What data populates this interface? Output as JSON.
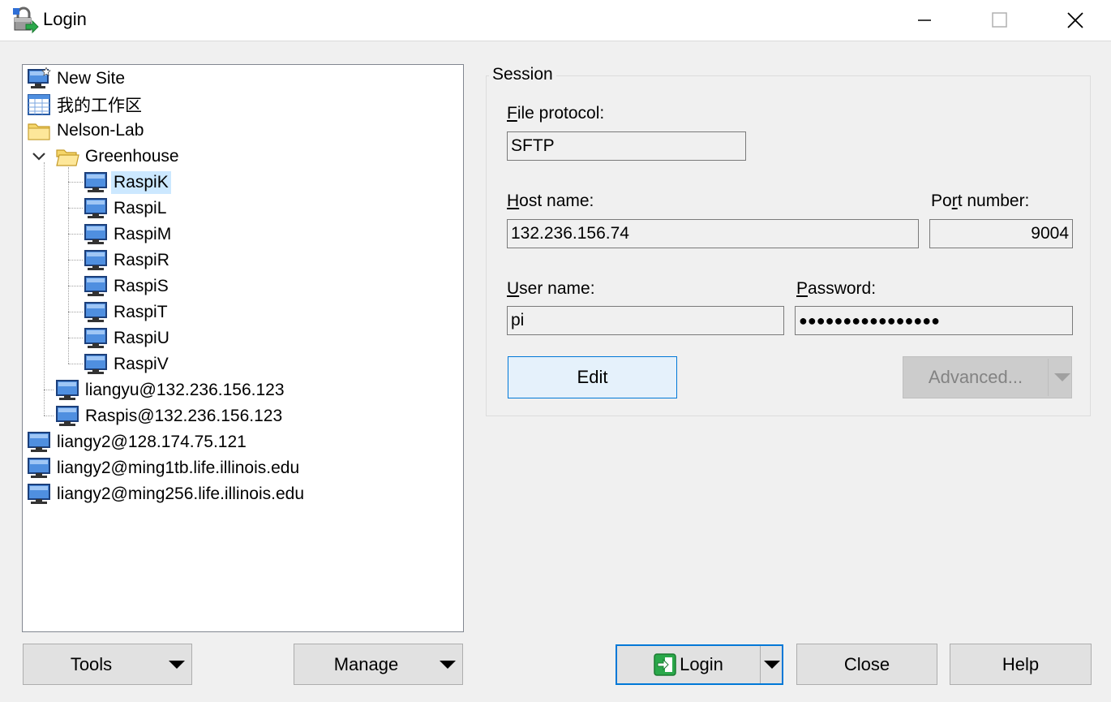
{
  "window": {
    "title": "Login",
    "app_icon": "login-lock-icon"
  },
  "tree": {
    "items": [
      {
        "label": "New Site",
        "icon": "new-site-monitor-icon"
      },
      {
        "label": "我的工作区",
        "icon": "workspace-icon"
      },
      {
        "label": "Nelson-Lab",
        "icon": "folder-icon"
      },
      {
        "label": "Greenhouse",
        "icon": "folder-open-icon",
        "expanded": true
      },
      {
        "label": "RaspiK",
        "icon": "monitor-icon",
        "selected": true
      },
      {
        "label": "RaspiL",
        "icon": "monitor-icon"
      },
      {
        "label": "RaspiM",
        "icon": "monitor-icon"
      },
      {
        "label": "RaspiR",
        "icon": "monitor-icon"
      },
      {
        "label": "RaspiS",
        "icon": "monitor-icon"
      },
      {
        "label": "RaspiT",
        "icon": "monitor-icon"
      },
      {
        "label": "RaspiU",
        "icon": "monitor-icon"
      },
      {
        "label": "RaspiV",
        "icon": "monitor-icon"
      },
      {
        "label": "liangyu@132.236.156.123",
        "icon": "monitor-icon"
      },
      {
        "label": "Raspis@132.236.156.123",
        "icon": "monitor-icon"
      },
      {
        "label": "liangy2@128.174.75.121",
        "icon": "monitor-icon"
      },
      {
        "label": "liangy2@ming1tb.life.illinois.edu",
        "icon": "monitor-icon"
      },
      {
        "label": "liangy2@ming256.life.illinois.edu",
        "icon": "monitor-icon"
      }
    ]
  },
  "session": {
    "group_label": "Session",
    "protocol": {
      "label_key": "F",
      "label_rest": "ile protocol:",
      "value": "SFTP"
    },
    "host": {
      "label_key": "H",
      "label_rest": "ost name:",
      "value": "132.236.156.74"
    },
    "port": {
      "label_pre": "Po",
      "label_key": "r",
      "label_rest": "t number:",
      "value": "9004"
    },
    "user": {
      "label_key": "U",
      "label_rest": "ser name:",
      "value": "pi"
    },
    "password": {
      "label_key": "P",
      "label_rest": "assword:",
      "value": "●●●●●●●●●●●●●●●●"
    },
    "edit_label": "Edit",
    "advanced_label": "Advanced..."
  },
  "buttons": {
    "tools": "Tools",
    "manage": "Manage",
    "login": "Login",
    "close": "Close",
    "help": "Help"
  },
  "colors": {
    "accent": "#0078d7",
    "selection": "#cce8ff",
    "background": "#f0f0f0"
  }
}
